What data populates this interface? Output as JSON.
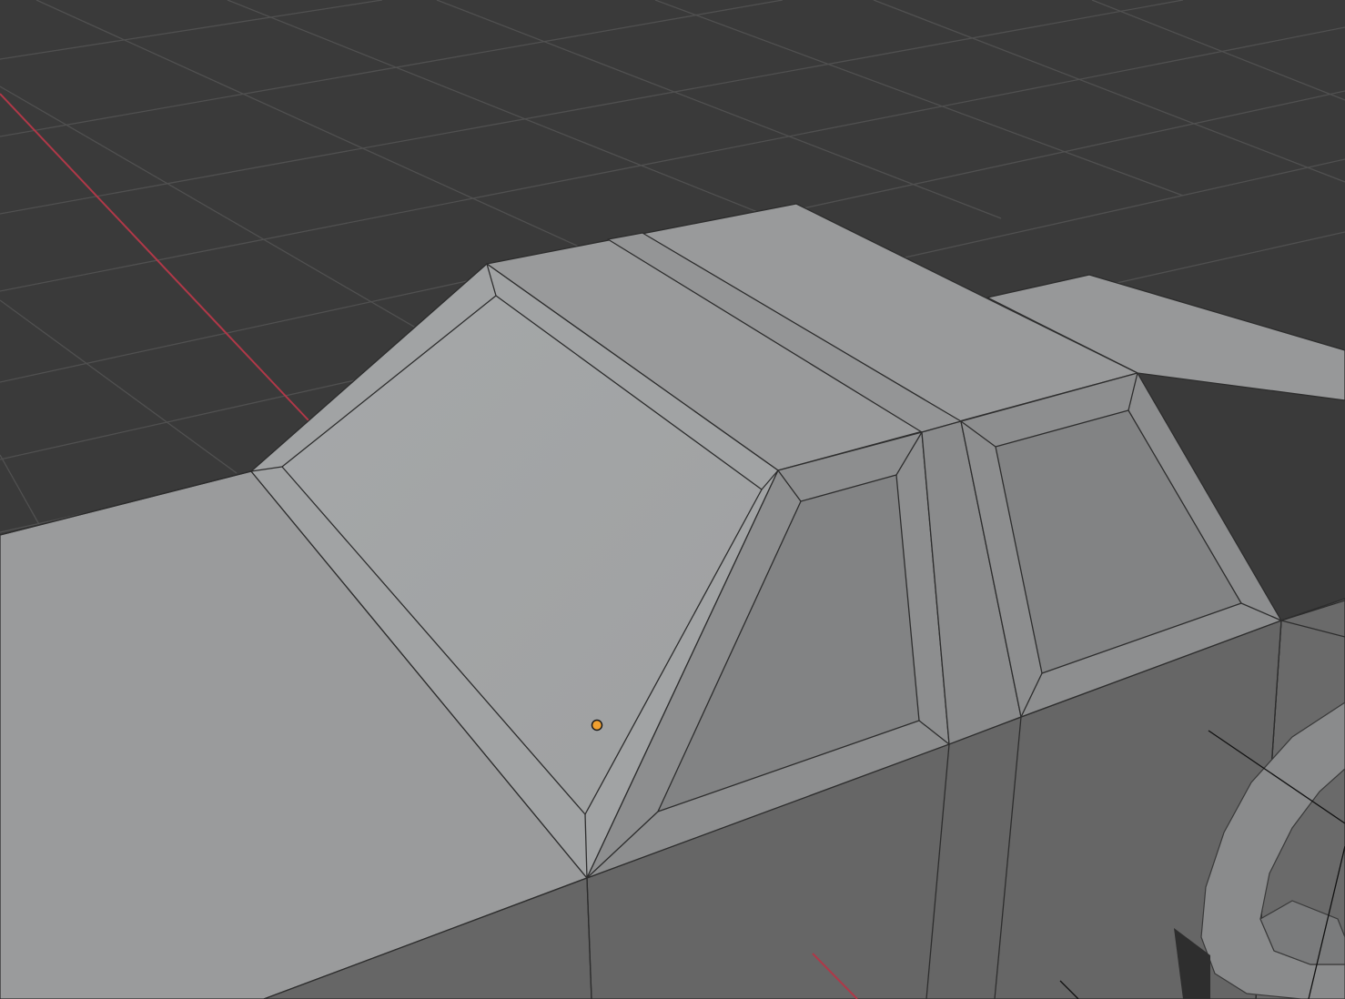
{
  "viewport": {
    "mode": "3d-viewport-solid",
    "background_color": "#3a3a3a",
    "grid_color": "#525252",
    "x_axis_color": "#c0404f",
    "edge_color": "#2a2a2a",
    "origin_color": "#f0a030",
    "object_fill_top": "#9c9d9e",
    "object_fill_side": "#676767"
  },
  "scene": {
    "object": "car-body-mesh",
    "parts": [
      "windshield-panel",
      "roof-panel",
      "side-window-front",
      "side-window-rear",
      "wheel-arch"
    ]
  }
}
